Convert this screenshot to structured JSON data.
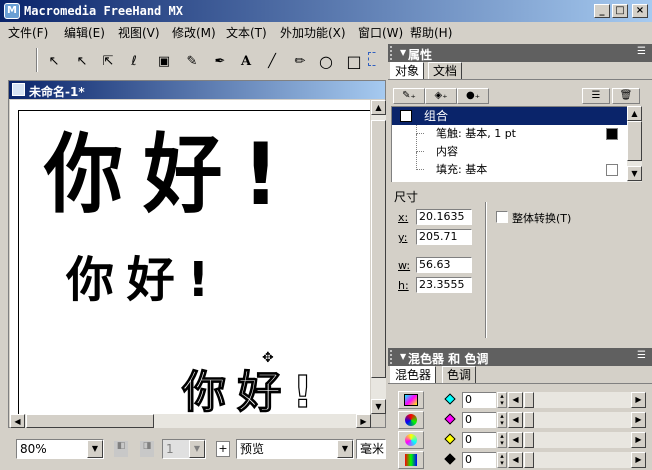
{
  "app": {
    "title": "Macromedia FreeHand MX",
    "icon_label": "M"
  },
  "window_controls": {
    "minimize": "_",
    "maximize": "□",
    "close": "×"
  },
  "menu": [
    "文件(F)",
    "编辑(E)",
    "视图(V)",
    "修改(M)",
    "文本(T)",
    "外加功能(X)",
    "窗口(W)",
    "帮助(H)"
  ],
  "toolbar": {
    "tools": [
      {
        "name": "pointer-tool",
        "glyph": "↖"
      },
      {
        "name": "subselect-tool",
        "glyph": "↖"
      },
      {
        "name": "page-tool",
        "glyph": "⇱"
      },
      {
        "name": "lasso-tool",
        "glyph": "ℓ"
      },
      {
        "name": "trace-tool",
        "glyph": "▣"
      },
      {
        "name": "eyedropper-tool",
        "glyph": "✎"
      },
      {
        "name": "pen-tool",
        "glyph": "✒"
      },
      {
        "name": "text-tool",
        "glyph": "A"
      },
      {
        "name": "line-tool",
        "glyph": "╱"
      },
      {
        "name": "pencil-tool",
        "glyph": "✏"
      },
      {
        "name": "ellipse-tool",
        "glyph": "○"
      },
      {
        "name": "rectangle-tool",
        "glyph": "□"
      }
    ]
  },
  "document": {
    "title": "未命名-1*",
    "texts": {
      "large": "你 好 !",
      "medium": "你 好 !",
      "outlined": "你 好 !"
    }
  },
  "statusbar": {
    "zoom": "80%",
    "page": "1",
    "view_mode": "预览",
    "units": "毫米"
  },
  "properties_panel": {
    "title": "属性",
    "tabs": [
      "对象",
      "文档"
    ],
    "tree": {
      "group_label": "组合",
      "stroke_label": "笔触: 基本, 1 pt",
      "content_label": "内容",
      "fill_label": "填充: 基本"
    },
    "size_label": "尺寸",
    "x_label": "x:",
    "x_value": "20.1635",
    "y_label": "y:",
    "y_value": "205.71",
    "w_label": "w:",
    "w_value": "56.63",
    "h_label": "h:",
    "h_value": "23.3555",
    "transform_as_unit_label": "整体转换(T)"
  },
  "mixer_panel": {
    "title": "混色器 和 色调",
    "tabs": [
      "混色器",
      "色调"
    ],
    "rows": [
      {
        "swatch": "cyan",
        "value": "0"
      },
      {
        "swatch": "magenta",
        "value": "0"
      },
      {
        "swatch": "yellow",
        "value": "0"
      },
      {
        "swatch": "black",
        "value": "0"
      }
    ]
  },
  "colors": {
    "title_bar": "#0a246a",
    "panel_header": "#606060",
    "selected_row": "#0a246a",
    "cyan": "#00ffff",
    "magenta": "#ff00ff",
    "yellow": "#ffff00",
    "black": "#000000"
  }
}
